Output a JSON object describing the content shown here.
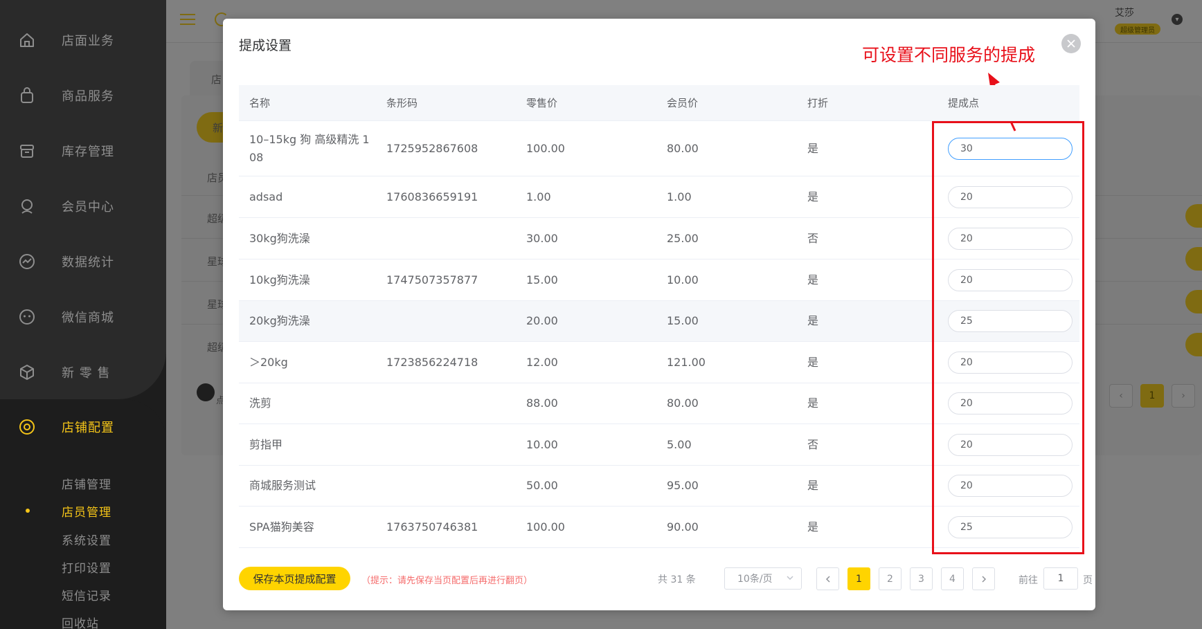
{
  "sidebar": {
    "items": [
      {
        "label": "店面业务",
        "icon": "home-icon"
      },
      {
        "label": "商品服务",
        "icon": "shopping-bag-icon"
      },
      {
        "label": "库存管理",
        "icon": "archive-icon"
      },
      {
        "label": "会员中心",
        "icon": "member-icon"
      },
      {
        "label": "数据统计",
        "icon": "chart-icon"
      },
      {
        "label": "微信商城",
        "icon": "wechat-icon"
      },
      {
        "label": "新 零 售",
        "icon": "cube-icon"
      },
      {
        "label": "店铺配置",
        "icon": "target-icon"
      }
    ],
    "sub_items": [
      "店铺管理",
      "店员管理",
      "系统设置",
      "打印设置",
      "短信记录",
      "回收站"
    ],
    "active_sub": "店员管理"
  },
  "header": {
    "user_name": "艾莎",
    "user_role": "超级管理员"
  },
  "background": {
    "tab_label": "店",
    "new_button": "新",
    "table_header": "店员",
    "rows": [
      "超级",
      "星球",
      "星球",
      "超级"
    ],
    "tip_text": "点",
    "pager_current": "1"
  },
  "modal": {
    "title": "提成设置",
    "annotation": "可设置不同服务的提成",
    "columns": [
      "名称",
      "条形码",
      "零售价",
      "会员价",
      "打折",
      "提成点"
    ],
    "rows": [
      {
        "name": "10–15kg 狗 高级精洗 1 08",
        "barcode": "1725952867608",
        "retail": "100.00",
        "member": "80.00",
        "discount": "是",
        "commission": "30"
      },
      {
        "name": "adsad",
        "barcode": "1760836659191",
        "retail": "1.00",
        "member": "1.00",
        "discount": "是",
        "commission": "20"
      },
      {
        "name": "30kg狗洗澡",
        "barcode": "",
        "retail": "30.00",
        "member": "25.00",
        "discount": "否",
        "commission": "20"
      },
      {
        "name": "10kg狗洗澡",
        "barcode": "1747507357877",
        "retail": "15.00",
        "member": "10.00",
        "discount": "是",
        "commission": "20"
      },
      {
        "name": "20kg狗洗澡",
        "barcode": "",
        "retail": "20.00",
        "member": "15.00",
        "discount": "是",
        "commission": "25"
      },
      {
        "name": "＞20kg",
        "barcode": "1723856224718",
        "retail": "12.00",
        "member": "121.00",
        "discount": "是",
        "commission": "20"
      },
      {
        "name": "洗剪",
        "barcode": "",
        "retail": "88.00",
        "member": "80.00",
        "discount": "是",
        "commission": "20"
      },
      {
        "name": "剪指甲",
        "barcode": "",
        "retail": "10.00",
        "member": "5.00",
        "discount": "否",
        "commission": "20"
      },
      {
        "name": "商城服务测试",
        "barcode": "",
        "retail": "50.00",
        "member": "95.00",
        "discount": "是",
        "commission": "20"
      },
      {
        "name": "SPA猫狗美容",
        "barcode": "1763750746381",
        "retail": "100.00",
        "member": "90.00",
        "discount": "是",
        "commission": "25"
      }
    ],
    "footer": {
      "save_label": "保存本页提成配置",
      "tip": "（提示：请先保存当页配置后再进行翻页）",
      "total": "共 31 条",
      "page_size": "10条/页",
      "pages": [
        "1",
        "2",
        "3",
        "4"
      ],
      "current_page": "1",
      "goto_label": "前往",
      "goto_value": "1",
      "goto_suffix": "页"
    }
  },
  "colors": {
    "accent": "#ffd400",
    "sidebar_bg": "#2a2a2a",
    "annotation": "#e8101a",
    "focus": "#409eff"
  }
}
